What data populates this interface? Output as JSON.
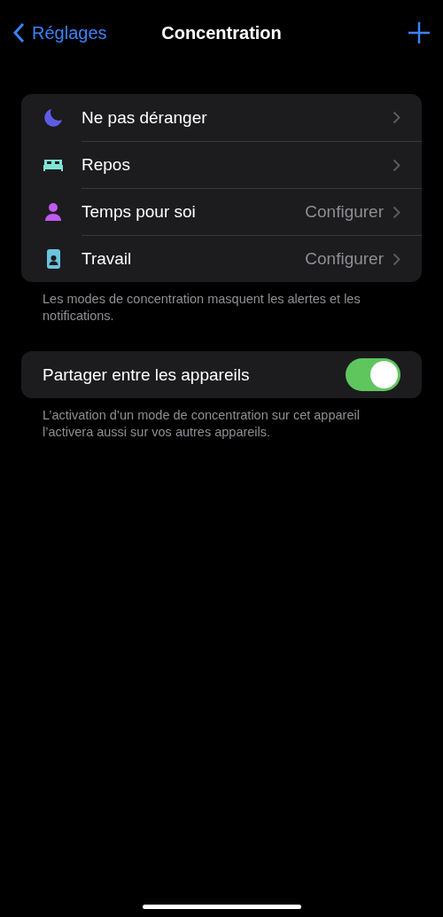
{
  "nav": {
    "back": "Réglages",
    "title": "Concentration"
  },
  "modes": [
    {
      "kind": "moon",
      "label": "Ne pas déranger"
    },
    {
      "kind": "bed",
      "label": "Repos"
    },
    {
      "kind": "person",
      "label": "Temps pour soi",
      "value": "Configurer"
    },
    {
      "kind": "badge",
      "label": "Travail",
      "value": "Configurer"
    }
  ],
  "modes_footer": "Les modes de concentration masquent les alertes et les notifications.",
  "share": {
    "label": "Partager entre les appareils",
    "on": true
  },
  "share_footer": "L’activation d’un mode de concentration sur cet appareil l’activera aussi sur vos autres appareils."
}
